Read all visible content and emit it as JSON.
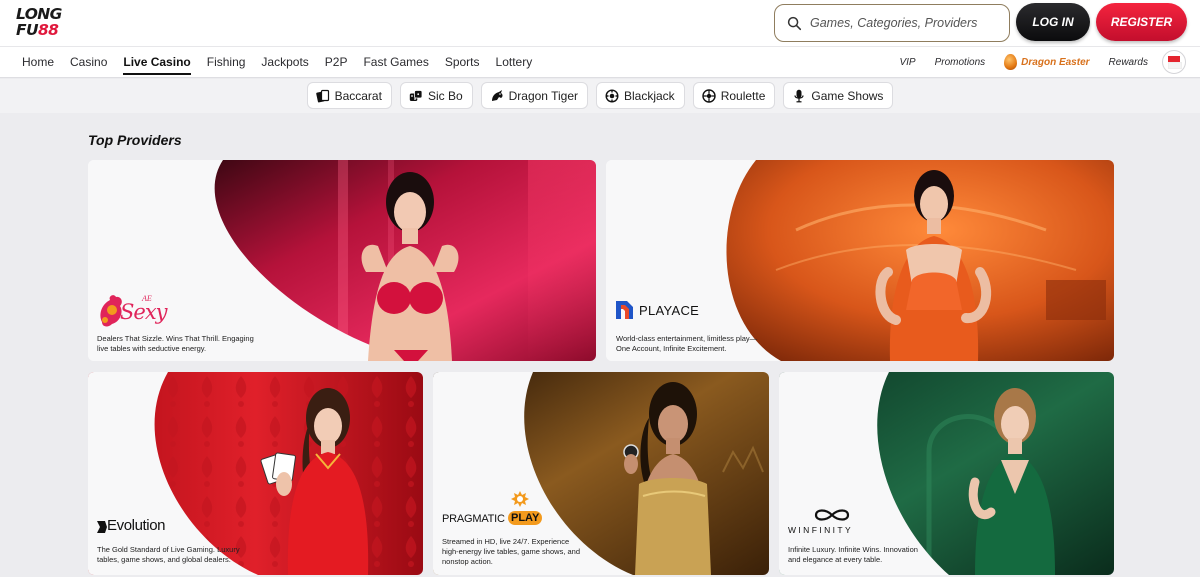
{
  "header": {
    "logo_line1": "LONG",
    "logo_line2_a": "FU",
    "logo_line2_b": "88",
    "search_placeholder": "Games, Categories, Providers",
    "login_label": "LOG IN",
    "register_label": "REGISTER"
  },
  "nav": {
    "items": [
      {
        "label": "Home"
      },
      {
        "label": "Casino"
      },
      {
        "label": "Live Casino"
      },
      {
        "label": "Fishing"
      },
      {
        "label": "Jackpots"
      },
      {
        "label": "P2P"
      },
      {
        "label": "Fast Games"
      },
      {
        "label": "Sports"
      },
      {
        "label": "Lottery"
      }
    ],
    "active": "Live Casino",
    "right": {
      "vip": "VIP",
      "promotions": "Promotions",
      "dragon_easter": "Dragon Easter",
      "rewards": "Rewards"
    }
  },
  "chips": [
    {
      "label": "Baccarat",
      "icon": "cards-icon"
    },
    {
      "label": "Sic Bo",
      "icon": "dice-icon"
    },
    {
      "label": "Dragon Tiger",
      "icon": "dragon-icon"
    },
    {
      "label": "Blackjack",
      "icon": "blackjack-icon"
    },
    {
      "label": "Roulette",
      "icon": "roulette-icon"
    },
    {
      "label": "Game Shows",
      "icon": "microphone-icon"
    }
  ],
  "section": {
    "title": "Top Providers"
  },
  "providers": [
    {
      "brand": "Sexy",
      "brand_prefix": "AE",
      "desc_line1": "Dealers That Sizzle. Wins That Thrill. Engaging",
      "desc_line2": "live tables with seductive energy.",
      "accent": "#e0245a"
    },
    {
      "brand": "PLAYACE",
      "desc_line1": "World-class entertainment, limitless play—",
      "desc_line2": "One Account, Infinite Excitement.",
      "accent": "#e0641e"
    },
    {
      "brand": "Evolution",
      "desc_line1": "The Gold Standard of Live Gaming. Luxury",
      "desc_line2": "tables, game shows, and global dealers.",
      "accent": "#d2151f"
    },
    {
      "brand_a": "PRAGMATIC",
      "brand_b": "PLAY",
      "desc_line1": "Streamed in HD, live 24/7. Experience",
      "desc_line2": "high-energy live tables, game shows, and",
      "desc_line3": "nonstop action.",
      "accent": "#f39a1d"
    },
    {
      "brand": "WINFINITY",
      "desc_line1": "Infinite Luxury. Infinite Wins. Innovation",
      "desc_line2": "and elegance at every table.",
      "accent": "#1f6b45"
    }
  ]
}
